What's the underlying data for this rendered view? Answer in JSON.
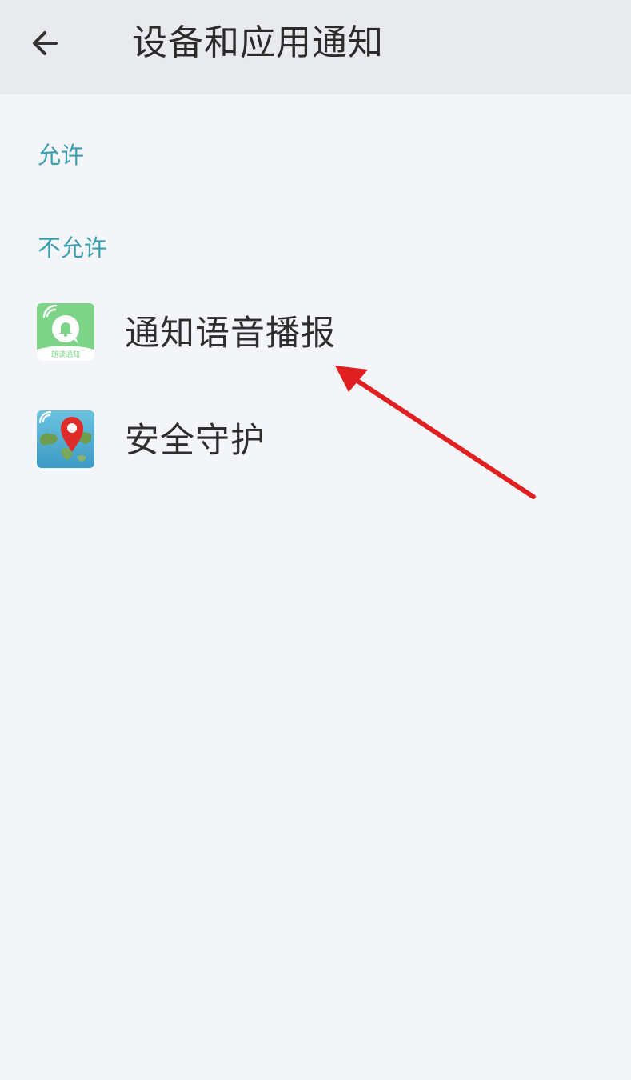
{
  "header": {
    "title": "设备和应用通知"
  },
  "sections": {
    "allowed_label": "允许",
    "not_allowed_label": "不允许"
  },
  "apps": [
    {
      "name": "通知语音播报",
      "icon_caption": "朗读通知",
      "icon": "notification-voice-app-icon",
      "accent": "#7dd489"
    },
    {
      "name": "安全守护",
      "icon": "location-pin-map-app-icon",
      "accent": "#e02b2b"
    }
  ],
  "colors": {
    "section_label": "#3a9fb0",
    "annotation_arrow": "#e02020"
  }
}
